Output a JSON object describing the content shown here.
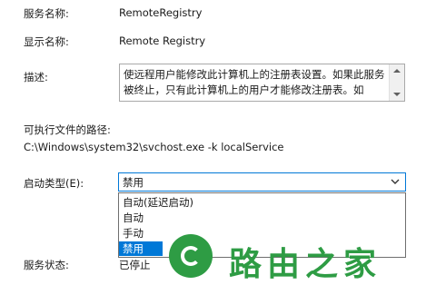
{
  "fields": {
    "service_name_label": "服务名称:",
    "service_name_value": "RemoteRegistry",
    "display_name_label": "显示名称:",
    "display_name_value": "Remote Registry",
    "description_label": "描述:",
    "description_value": "使远程用户能修改此计算机上的注册表设置。如果此服务被终止，只有此计算机上的用户才能修改注册表。如",
    "exe_path_label": "可执行文件的路径:",
    "exe_path_value": "C:\\Windows\\system32\\svchost.exe -k localService",
    "startup_type_label": "启动类型(E):",
    "service_status_label": "服务状态:",
    "service_status_value": "已停止"
  },
  "startup_select": {
    "selected": "禁用",
    "options": [
      "自动(延迟启动)",
      "自动",
      "手动",
      "禁用"
    ]
  },
  "watermark": {
    "text": "路由之家"
  },
  "colors": {
    "accent": "#0078d7",
    "watermark": "#2e9c44"
  }
}
